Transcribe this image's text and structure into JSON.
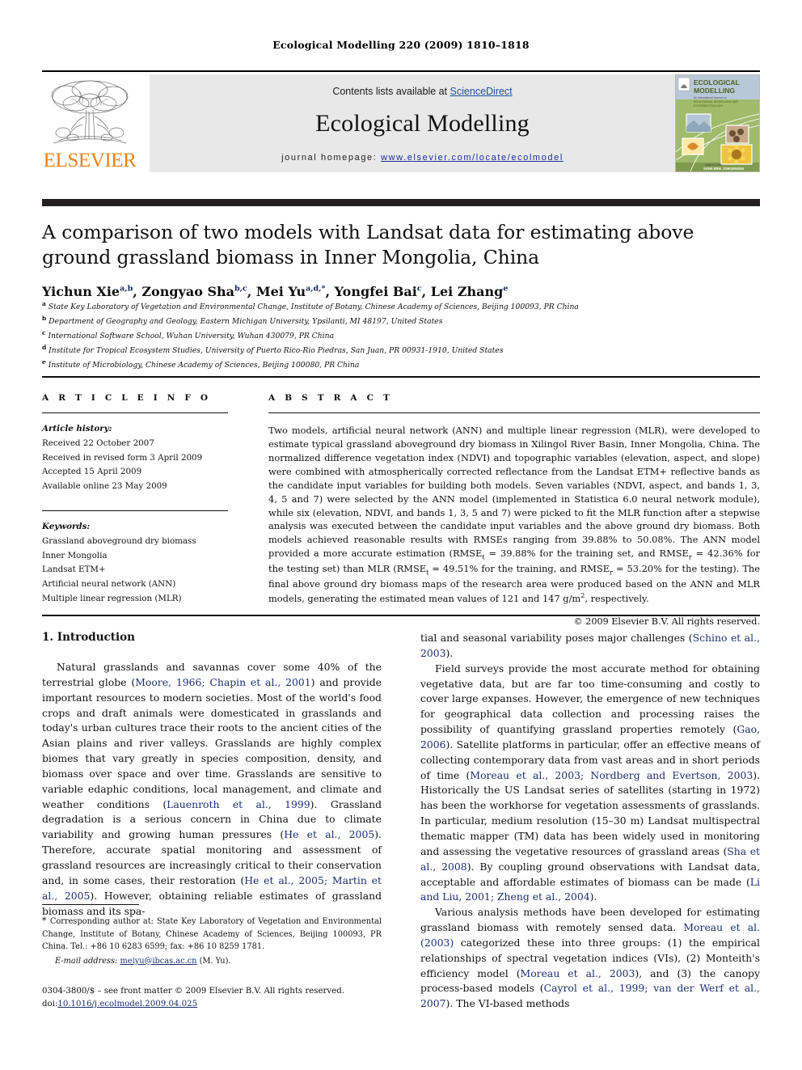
{
  "running_head": "Ecological Modelling 220 (2009) 1810–1818",
  "header": {
    "contents_prefix": "Contents lists available at ",
    "sciencedirect": "ScienceDirect",
    "journal_title": "Ecological Modelling",
    "homepage_prefix": "journal homepage:",
    "homepage_url": "www.elsevier.com/locate/ecolmodel",
    "publisher_wordmark": "ELSEVIER",
    "cover_title_line1": "ECOLOGICAL",
    "cover_title_line2": "MODELLING",
    "colors": {
      "elsevier_orange": "#ee8019",
      "link_blue": "#1a4f9c",
      "band_grey": "#e8e8e8",
      "rule_black": "#231f20"
    }
  },
  "article": {
    "title": "A comparison of two models with Landsat data for estimating above ground grassland biomass in Inner Mongolia, China",
    "authors": [
      {
        "name": "Yichun Xie",
        "sup": "a,b",
        "sep": ", "
      },
      {
        "name": "Zongyao Sha",
        "sup": "b,c",
        "sep": ", "
      },
      {
        "name": "Mei Yu",
        "sup": "a,d,*",
        "sep": ", "
      },
      {
        "name": "Yongfei Bai",
        "sup": "c",
        "sep": ", "
      },
      {
        "name": "Lei Zhang",
        "sup": "e",
        "sep": ""
      }
    ],
    "affiliations": [
      {
        "mark": "a",
        "text": "State Key Laboratory of Vegetation and Environmental Change, Institute of Botany, Chinese Academy of Sciences, Beijing 100093, PR China"
      },
      {
        "mark": "b",
        "text": "Department of Geography and Geology, Eastern Michigan University, Ypsilanti, MI 48197, United States"
      },
      {
        "mark": "c",
        "text": "International Software School, Wuhan University, Wuhan 430079, PR China"
      },
      {
        "mark": "d",
        "text": "Institute for Tropical Ecosystem Studies, University of Puerto Rico-Rio Piedras, San Juan, PR 00931-1910, United States"
      },
      {
        "mark": "e",
        "text": "Institute of Microbiology, Chinese Academy of Sciences, Beijing 100080, PR China"
      }
    ]
  },
  "article_info": {
    "heading": "A R T I C L E  I N F O",
    "history_label": "Article history:",
    "history": [
      "Received 22 October 2007",
      "Received in revised form 3 April 2009",
      "Accepted 15 April 2009",
      "Available online 23 May 2009"
    ],
    "keywords_label": "Keywords:",
    "keywords": [
      "Grassland aboveground dry biomass",
      "Inner Mongolia",
      "Landsat ETM+",
      "Artificial neural network (ANN)",
      "Multiple linear regression (MLR)"
    ]
  },
  "abstract": {
    "heading": "A B S T R A C T",
    "text": "Two models, artificial neural network (ANN) and multiple linear regression (MLR), were developed to estimate typical grassland aboveground dry biomass in Xilingol River Basin, Inner Mongolia, China. The normalized difference vegetation index (NDVI) and topographic variables (elevation, aspect, and slope) were combined with atmospherically corrected reflectance from the Landsat ETM+ reflective bands as the candidate input variables for building both models. Seven variables (NDVI, aspect, and bands 1, 3, 4, 5 and 7) were selected by the ANN model (implemented in Statistica 6.0 neural network module), while six (elevation, NDVI, and bands 1, 3, 5 and 7) were picked to fit the MLR function after a stepwise analysis was executed between the candidate input variables and the above ground dry biomass. Both models achieved reasonable results with RMSEs ranging from 39.88% to 50.08%. The ANN model provided a more accurate estimation (RMSE",
    "text_part2": " = 39.88% for the training set, and RMSE",
    "text_part3": " = 42.36% for the testing set) than MLR (RMSE",
    "text_part4": " = 49.51% for the training, and RMSE",
    "text_part5": " = 53.20% for the testing). The final above ground dry biomass maps of the research area were produced based on the ANN and MLR models, generating the estimated mean values of 121 and 147 g/m",
    "text_part6": ", respectively.",
    "sub_t": "t",
    "sub_r": "r",
    "sup_2": "2",
    "copyright": "© 2009 Elsevier B.V. All rights reserved."
  },
  "introduction": {
    "section_number_title": "1. Introduction",
    "left_paragraph_1_a": "Natural grasslands and savannas cover some 40% of the terrestrial globe (",
    "left_cite_1": "Moore, 1966; Chapin et al., 2001",
    "left_paragraph_1_b": ") and provide important resources to modern societies. Most of the world's food crops and draft animals were domesticated in grasslands and today's urban cultures trace their roots to the ancient cities of the Asian plains and river valleys. Grasslands are highly complex biomes that vary greatly in species composition, density, and biomass over space and over time. Grasslands are sensitive to variable edaphic conditions, local management, and climate and weather conditions (",
    "left_cite_2": "Lauenroth et al., 1999",
    "left_paragraph_1_c": "). Grassland degradation is a serious concern in China due to climate variability and growing human pressures (",
    "left_cite_3": "He et al., 2005",
    "left_paragraph_1_d": "). Therefore, accurate spatial monitoring and assessment of grassland resources are increasingly critical to their conservation and, in some cases, their restoration (",
    "left_cite_4": "He et al., 2005; Martin et al., 2005",
    "left_paragraph_1_e": "). However, obtaining reliable estimates of grassland biomass and its spa-",
    "right_para_1_a": "tial and seasonal variability poses major challenges (",
    "right_cite_1": "Schino et al., 2003",
    "right_para_1_b": ").",
    "right_para_2_a": "Field surveys provide the most accurate method for obtaining vegetative data, but are far too time-consuming and costly to cover large expanses. However, the emergence of new techniques for geographical data collection and processing raises the possibility of quantifying grassland properties remotely (",
    "right_cite_2": "Gao, 2006",
    "right_para_2_b": "). Satellite platforms in particular, offer an effective means of collecting contemporary data from vast areas and in short periods of time (",
    "right_cite_3": "Moreau et al., 2003; Nordberg and Evertson, 2003",
    "right_para_2_c": "). Historically the US Landsat series of satellites (starting in 1972) has been the workhorse for vegetation assessments of grasslands. In particular, medium resolution (15–30 m) Landsat multispectral thematic mapper (TM) data has been widely used in monitoring and assessing the vegetative resources of grassland areas (",
    "right_cite_4": "Sha et al., 2008",
    "right_para_2_d": "). By coupling ground observations with Landsat data, acceptable and affordable estimates of biomass can be made (",
    "right_cite_5": "Li and Liu, 2001; Zheng et al., 2004",
    "right_para_2_e": ").",
    "right_para_3_a": "Various analysis methods have been developed for estimating grassland biomass with remotely sensed data. ",
    "right_cite_6": "Moreau et al. (2003)",
    "right_para_3_b": " categorized these into three groups: (1) the empirical relationships of spectral vegetation indices (VIs), (2) Monteith's efficiency model (",
    "right_cite_7": "Moreau et al., 2003",
    "right_para_3_c": "), and (3) the canopy process-based models (",
    "right_cite_8": "Cayrol et al., 1999; van der Werf et al., 2007",
    "right_para_3_d": "). The VI-based methods"
  },
  "footnote": {
    "star": "*",
    "corresponding": "Corresponding author at: State Key Laboratory of Vegetation and Environmental Change, Institute of Botany, Chinese Academy of Sciences, Beijing 100093, PR China. Tel.: +86 10 6283 6599; fax: +86 10 8259 1781.",
    "email_label": "E-mail address:",
    "email": "meiyu@ibcas.ac.cn",
    "email_suffix": " (M. Yu).",
    "issn_line": "0304-3800/$ – see front matter © 2009 Elsevier B.V. All rights reserved.",
    "doi_label": "doi:",
    "doi": "10.1016/j.ecolmodel.2009.04.025"
  }
}
